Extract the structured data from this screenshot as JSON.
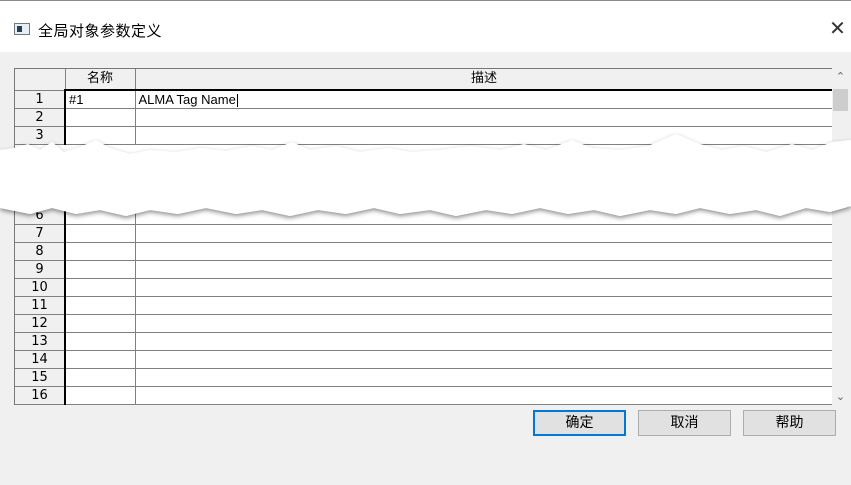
{
  "window": {
    "title": "全局对象参数定义",
    "close_glyph": "✕"
  },
  "grid": {
    "columns": [
      "名称",
      "描述"
    ],
    "rows_top": [
      {
        "num": "1",
        "name": "#1",
        "desc": "ALMA Tag Name"
      },
      {
        "num": "2",
        "name": "",
        "desc": ""
      },
      {
        "num": "3",
        "name": "",
        "desc": ""
      }
    ],
    "rows_bottom": [
      {
        "num": "6",
        "name": "",
        "desc": ""
      },
      {
        "num": "7",
        "name": "",
        "desc": ""
      },
      {
        "num": "8",
        "name": "",
        "desc": ""
      },
      {
        "num": "9",
        "name": "",
        "desc": ""
      },
      {
        "num": "10",
        "name": "",
        "desc": ""
      },
      {
        "num": "11",
        "name": "",
        "desc": ""
      },
      {
        "num": "12",
        "name": "",
        "desc": ""
      },
      {
        "num": "13",
        "name": "",
        "desc": ""
      },
      {
        "num": "14",
        "name": "",
        "desc": ""
      },
      {
        "num": "15",
        "name": "",
        "desc": ""
      },
      {
        "num": "16",
        "name": "",
        "desc": ""
      }
    ]
  },
  "scrollbar": {
    "up_glyph": "⌃",
    "down_glyph": "⌄"
  },
  "buttons": {
    "ok": "确定",
    "cancel": "取消",
    "help": "帮助"
  }
}
